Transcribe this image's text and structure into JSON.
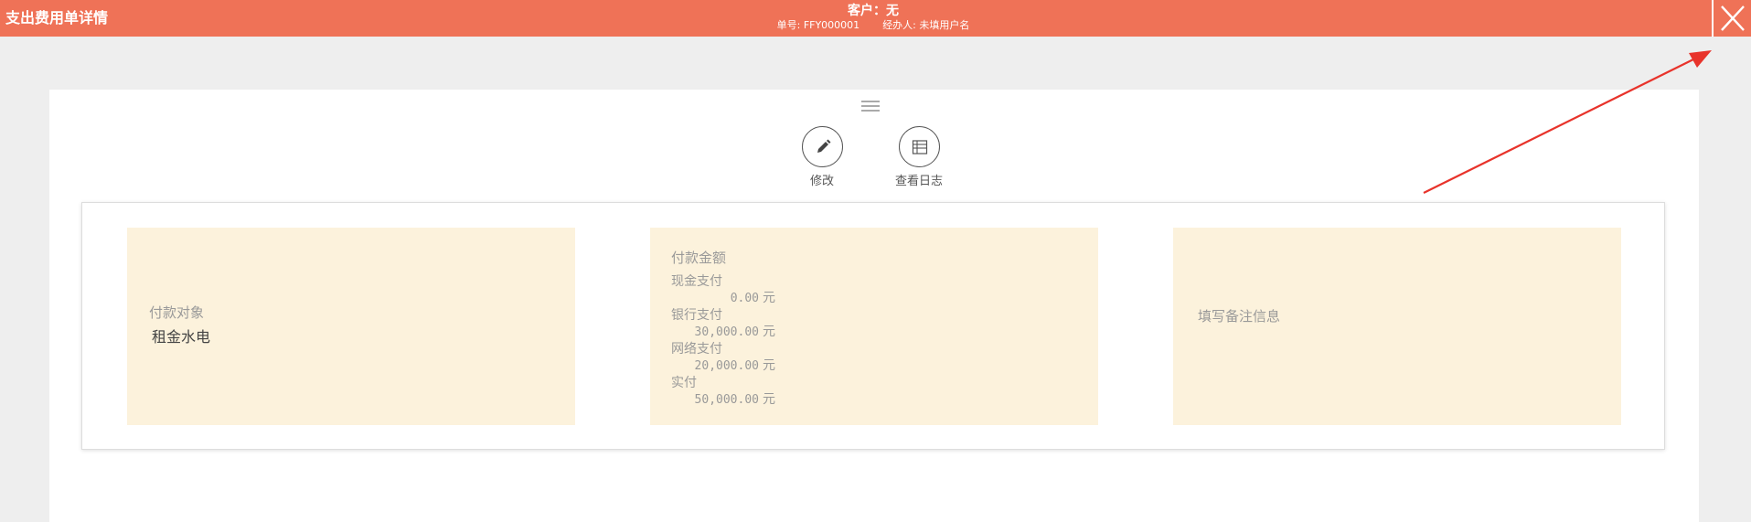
{
  "header": {
    "title": "支出费用单详情",
    "customer": "客户：无",
    "order_no_label": "单号:",
    "order_no": "FFY000001",
    "handler_label": "经办人:",
    "handler": "未填用户名"
  },
  "actions": {
    "edit_label": "修改",
    "log_label": "查看日志"
  },
  "payee": {
    "label": "付款对象",
    "value": "租金水电"
  },
  "amount": {
    "title": "付款金额",
    "rows": [
      {
        "label": "现金支付",
        "value": "0.00",
        "unit": "元"
      },
      {
        "label": "银行支付",
        "value": "30,000.00",
        "unit": "元"
      },
      {
        "label": "网络支付",
        "value": "20,000.00",
        "unit": "元"
      },
      {
        "label": "实付",
        "value": "50,000.00",
        "unit": "元"
      }
    ]
  },
  "remark": {
    "placeholder": "填写备注信息"
  },
  "colors": {
    "header_bg": "#ef7257",
    "box_bg": "#fcf2dc",
    "annotation_arrow": "#e8332b"
  },
  "icons": {
    "close": "close-icon",
    "menu": "menu-icon",
    "edit": "pencil-icon",
    "log": "log-icon"
  }
}
